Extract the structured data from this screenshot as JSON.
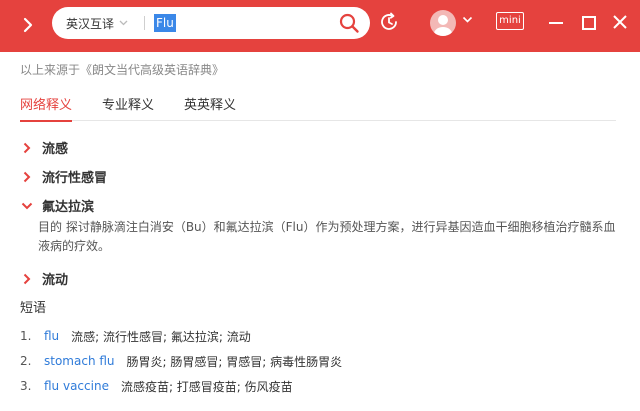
{
  "header": {
    "mode_label": "英汉互译",
    "query_value": "Flu",
    "mini_label": "mini"
  },
  "source_note": "以上来源于《朗文当代高级英语辞典》",
  "tabs": [
    {
      "label": "网络释义",
      "active": true
    },
    {
      "label": "专业释义",
      "active": false
    },
    {
      "label": "英英释义",
      "active": false
    }
  ],
  "senses": [
    {
      "label": "流感",
      "expanded": false
    },
    {
      "label": "流行性感冒",
      "expanded": false
    },
    {
      "label": "氟达拉滨",
      "expanded": true
    },
    {
      "label": "流动",
      "expanded": false
    }
  ],
  "example": "目的 探讨静脉滴注白消安（Bu）和氟达拉滨（Flu）作为预处理方案，进行异基因造血干细胞移植治疗髓系血液病的疗效。",
  "phrases": {
    "title": "短语",
    "items": [
      {
        "num": "1.",
        "term": "flu",
        "translation": "流感;  流行性感冒;  氟达拉滨;  流动"
      },
      {
        "num": "2.",
        "term": "stomach flu",
        "translation": "肠胃炎;  肠胃感冒;  胃感冒;  病毒性肠胃炎"
      },
      {
        "num": "3.",
        "term": "flu vaccine",
        "translation": "流感疫苗;  打感冒疫苗;  伤风疫苗"
      }
    ]
  },
  "colors": {
    "accent": "#e5423e",
    "link": "#2f7bd9"
  }
}
